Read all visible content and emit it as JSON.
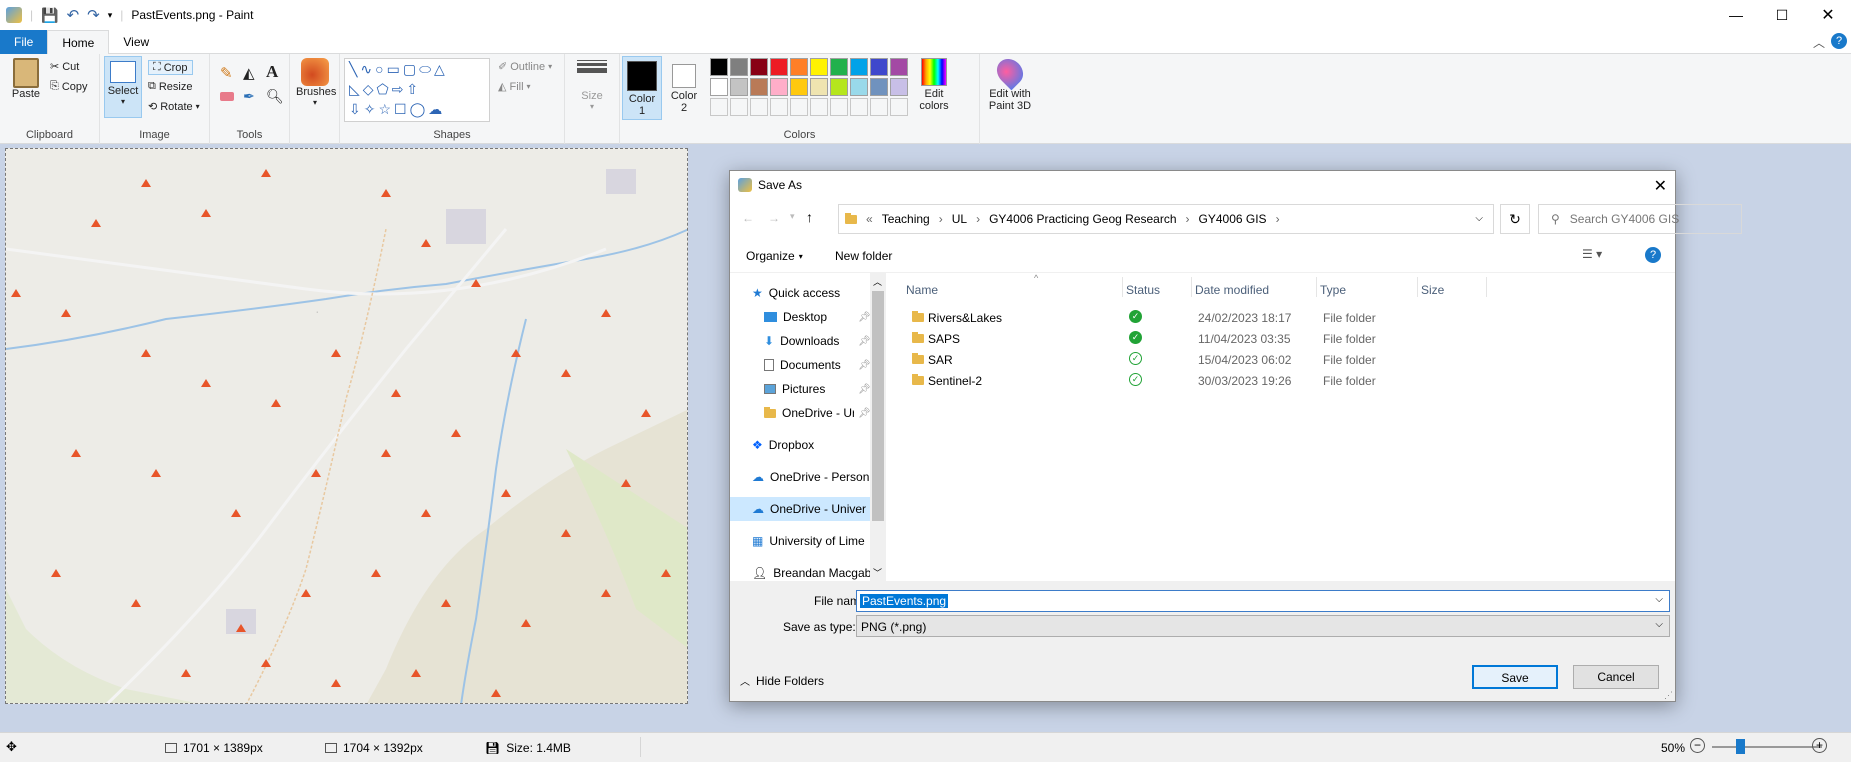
{
  "window": {
    "title": "PastEvents.png - Paint"
  },
  "ribbon_tabs": [
    "File",
    "Home",
    "View"
  ],
  "clipboard": {
    "paste": "Paste",
    "cut": "Cut",
    "copy": "Copy",
    "label": "Clipboard"
  },
  "image": {
    "select": "Select",
    "crop": "Crop",
    "resize": "Resize",
    "rotate": "Rotate",
    "label": "Image"
  },
  "tools": {
    "label": "Tools"
  },
  "brushes": {
    "label": "Brushes"
  },
  "shapes": {
    "outline": "Outline",
    "fill": "Fill",
    "label": "Shapes"
  },
  "size": {
    "label": "Size"
  },
  "colors": {
    "color1": "Color 1",
    "color2": "Color 2",
    "edit": "Edit colors",
    "paint3d": "Edit with Paint 3D",
    "label": "Colors",
    "palette_row1": [
      "#000000",
      "#7f7f7f",
      "#880015",
      "#ed1c24",
      "#ff7f27",
      "#fff200",
      "#22b14c",
      "#00a2e8",
      "#3f48cc",
      "#a349a4"
    ],
    "palette_row2": [
      "#ffffff",
      "#c3c3c3",
      "#b97a57",
      "#ffaec9",
      "#ffc90e",
      "#efe4b0",
      "#b5e61d",
      "#99d9ea",
      "#7092be",
      "#c8bfe7"
    ]
  },
  "status": {
    "dims1": "1701 × 1389px",
    "dims2": "1704 × 1392px",
    "size": "Size: 1.4MB",
    "zoom": "50%"
  },
  "dialog": {
    "title": "Save As",
    "breadcrumb": [
      "Teaching",
      "UL",
      "GY4006 Practicing Geog Research",
      "GY4006 GIS"
    ],
    "search_placeholder": "Search GY4006 GIS",
    "organize": "Organize",
    "new_folder": "New folder",
    "nav": [
      "Quick access",
      "Desktop",
      "Downloads",
      "Documents",
      "Pictures",
      "OneDrive - Ur",
      "Dropbox",
      "OneDrive - Person",
      "OneDrive - Univer",
      "University of Lime",
      "Breandan Macgab"
    ],
    "columns": [
      "Name",
      "Status",
      "Date modified",
      "Type",
      "Size"
    ],
    "files": [
      {
        "name": "Rivers&Lakes",
        "date": "24/02/2023 18:17",
        "type": "File folder"
      },
      {
        "name": "SAPS",
        "date": "11/04/2023 03:35",
        "type": "File folder"
      },
      {
        "name": "SAR",
        "date": "15/04/2023 06:02",
        "type": "File folder"
      },
      {
        "name": "Sentinel-2",
        "date": "30/03/2023 19:26",
        "type": "File folder"
      }
    ],
    "file_name_label": "File name:",
    "file_name_value": "PastEvents.png",
    "save_type_label": "Save as type:",
    "save_type_value": "PNG (*.png)",
    "hide_folders": "Hide Folders",
    "save": "Save",
    "cancel": "Cancel"
  }
}
